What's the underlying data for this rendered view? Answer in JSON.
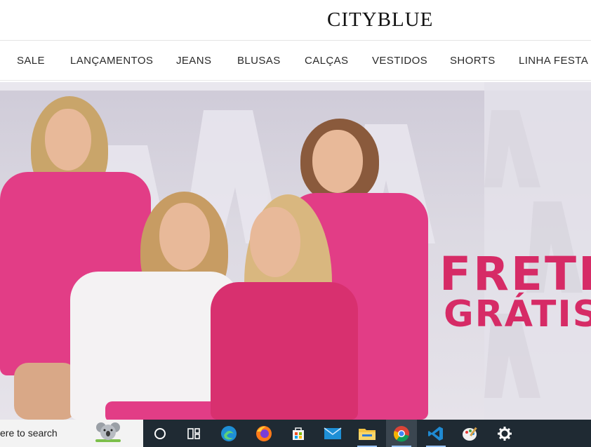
{
  "brand": {
    "logo": "CITYBLUE"
  },
  "nav": {
    "items": [
      {
        "label": "SALE"
      },
      {
        "label": "LANÇAMENTOS"
      },
      {
        "label": "JEANS"
      },
      {
        "label": "BLUSAS"
      },
      {
        "label": "CALÇAS"
      },
      {
        "label": "VESTIDOS"
      },
      {
        "label": "SHORTS"
      },
      {
        "label": "LINHA FESTA"
      }
    ]
  },
  "hero": {
    "promo_line1": "FRETE",
    "promo_line2": "GRÁTIS",
    "accent_color": "#d62b66",
    "outfit_color": "#e23d86"
  },
  "taskbar": {
    "search_placeholder": "ere to search",
    "icons": [
      {
        "name": "cortana-icon"
      },
      {
        "name": "task-view-icon"
      },
      {
        "name": "edge-icon"
      },
      {
        "name": "firefox-icon"
      },
      {
        "name": "microsoft-store-icon"
      },
      {
        "name": "mail-icon"
      },
      {
        "name": "file-explorer-icon"
      },
      {
        "name": "chrome-icon"
      },
      {
        "name": "vscode-icon"
      },
      {
        "name": "paint-icon"
      },
      {
        "name": "settings-icon"
      }
    ],
    "colors": {
      "bar": "#1f2a33",
      "active": "#3b4650"
    }
  }
}
